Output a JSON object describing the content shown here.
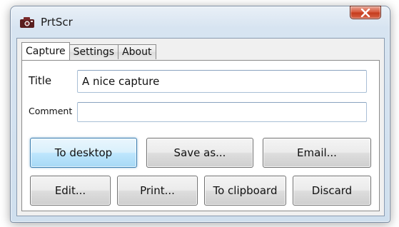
{
  "window": {
    "title": "PrtScr",
    "close_glyph": "X"
  },
  "tabs": [
    {
      "label": "Capture",
      "active": true
    },
    {
      "label": "Settings",
      "active": false
    },
    {
      "label": "About",
      "active": false
    }
  ],
  "capture": {
    "title_label": "Title",
    "title_value": "A nice capture",
    "comment_label": "Comment",
    "comment_value": ""
  },
  "buttons": {
    "to_desktop": "To desktop",
    "save_as": "Save as...",
    "email": "Email...",
    "edit": "Edit...",
    "print": "Print...",
    "to_clipboard": "To clipboard",
    "discard": "Discard"
  },
  "icons": {
    "app": "camera-icon",
    "close": "close-icon"
  },
  "colors": {
    "close_button": "#c53a1b",
    "default_button": "#bee6fd",
    "field_border": "#a9bfd6"
  }
}
